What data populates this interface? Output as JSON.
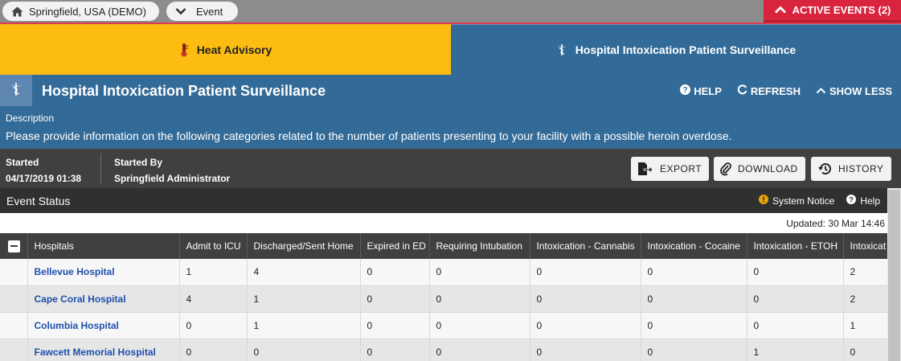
{
  "topbar": {
    "location": "Springfield, USA (DEMO)",
    "event_selector": "Event",
    "active_events": "ACTIVE EVENTS (2)"
  },
  "tabs": [
    {
      "label": "Heat Advisory",
      "color": "#fdbc11"
    },
    {
      "label": "Hospital Intoxication Patient Surveillance",
      "color": "#336b98"
    }
  ],
  "header": {
    "title": "Hospital Intoxication Patient Surveillance",
    "help": "HELP",
    "refresh": "REFRESH",
    "show_less": "SHOW LESS",
    "description_label": "Description",
    "description": "Please provide information on the following categories related to the number of patients presenting to your facility with a possible heroin overdose."
  },
  "info": {
    "started_label": "Started",
    "started_value": "04/17/2019 01:38",
    "started_by_label": "Started By",
    "started_by_value": "Springfield Administrator",
    "export": "EXPORT",
    "download": "DOWNLOAD",
    "history": "HISTORY"
  },
  "status": {
    "title": "Event Status",
    "system_notice": "System Notice",
    "help": "Help",
    "updated": "Updated: 30 Mar 14:46"
  },
  "table": {
    "columns": [
      "Hospitals",
      "Admit to ICU",
      "Discharged/Sent Home",
      "Expired in ED",
      "Requiring Intubation",
      "Intoxication - Cannabis",
      "Intoxication - Cocaine",
      "Intoxication - ETOH",
      "Intoxicat"
    ],
    "rows": [
      {
        "hospital": "Bellevue Hospital",
        "values": [
          "1",
          "4",
          "0",
          "0",
          "0",
          "0",
          "0",
          "2"
        ]
      },
      {
        "hospital": "Cape Coral Hospital",
        "values": [
          "4",
          "1",
          "0",
          "0",
          "0",
          "0",
          "0",
          "2"
        ]
      },
      {
        "hospital": "Columbia Hospital",
        "values": [
          "0",
          "1",
          "0",
          "0",
          "0",
          "0",
          "0",
          "1"
        ]
      },
      {
        "hospital": "Fawcett Memorial Hospital",
        "values": [
          "0",
          "0",
          "0",
          "0",
          "0",
          "0",
          "1",
          "0"
        ]
      }
    ]
  },
  "colors": {
    "accent_red": "#d8243c",
    "header_blue": "#336b98",
    "heat_yellow": "#fdbc11",
    "link_blue": "#1f4fad",
    "notice_yellow": "#e5a50a"
  }
}
